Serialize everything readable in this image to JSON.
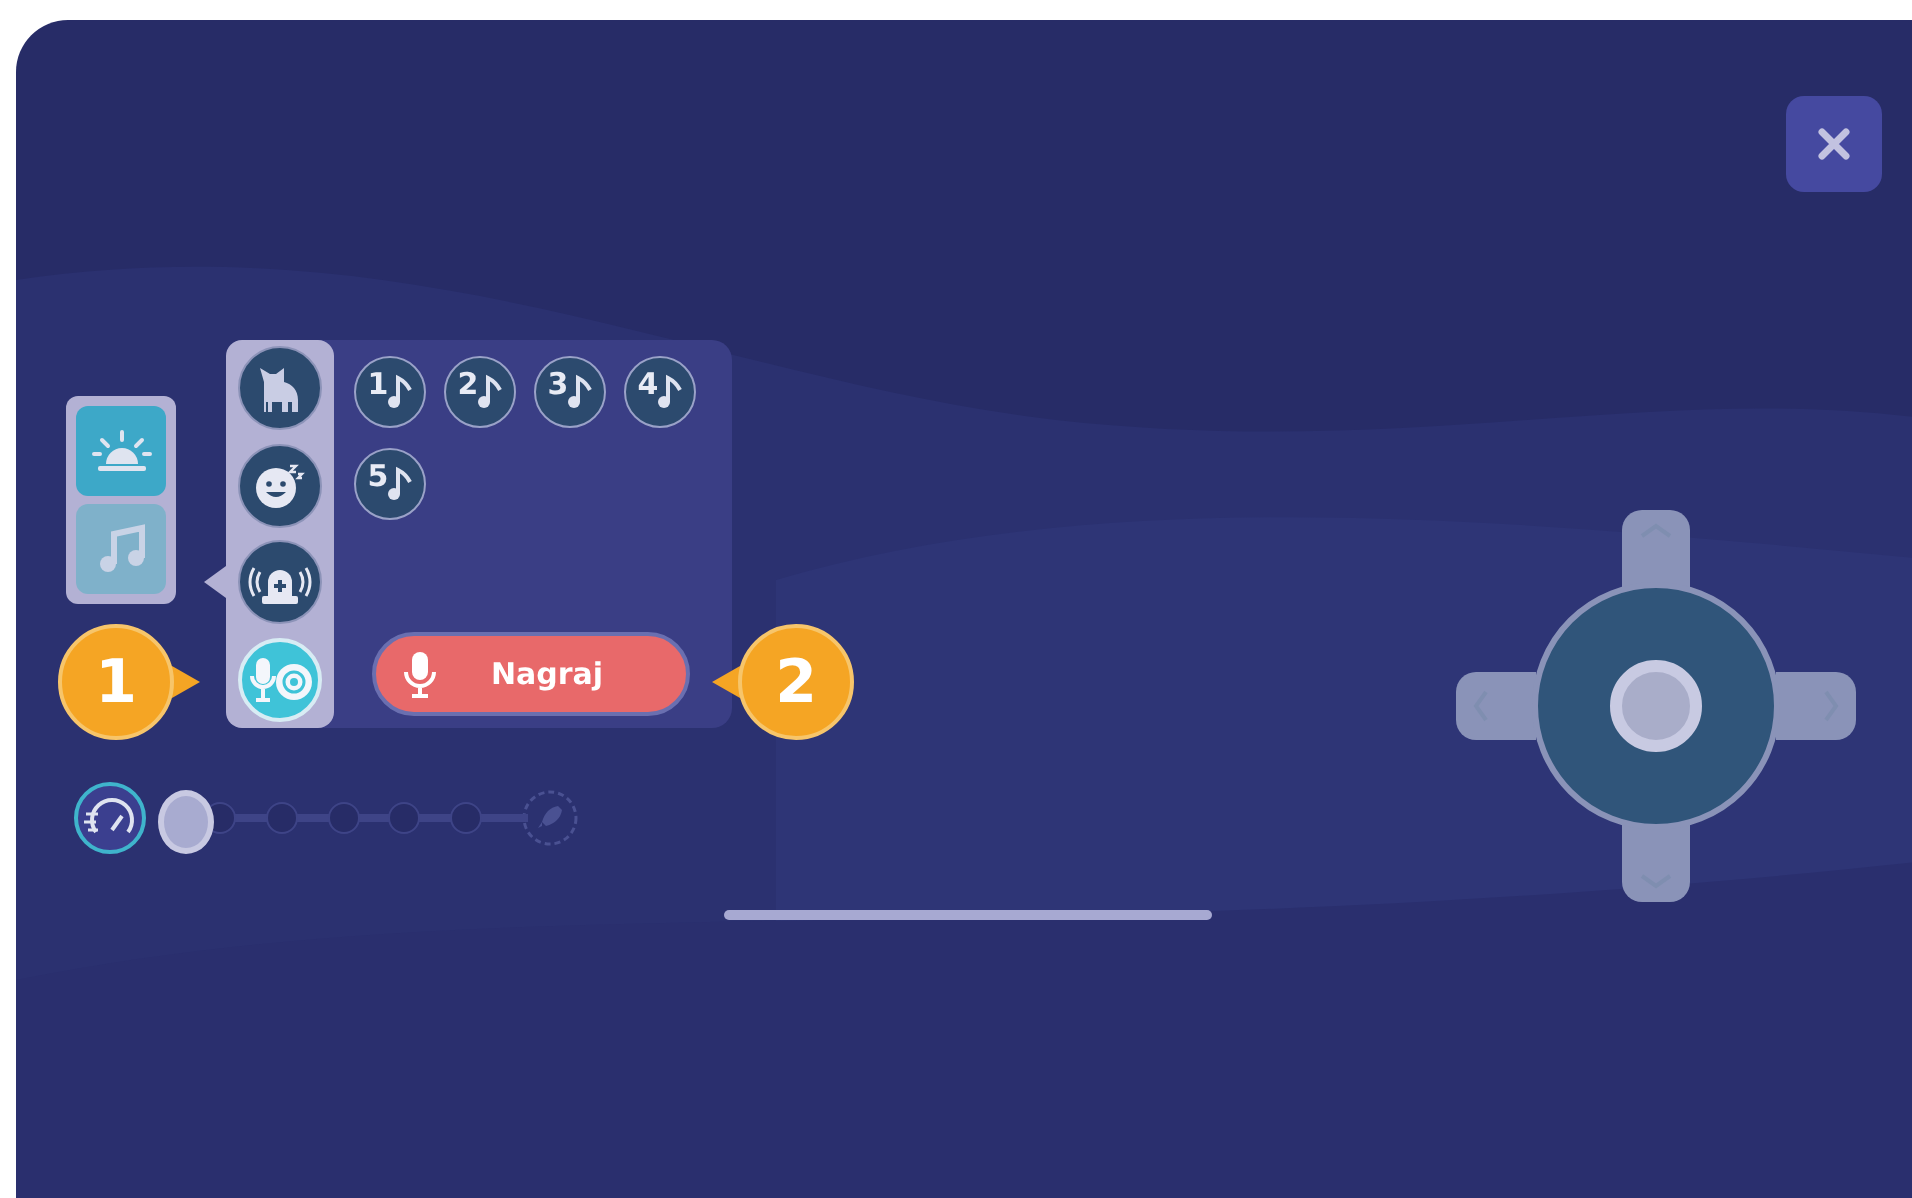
{
  "modes": [
    {
      "kind": "sunrise",
      "selected": false
    },
    {
      "kind": "music",
      "selected": true
    }
  ],
  "sound_categories": [
    {
      "kind": "cat",
      "selected": false
    },
    {
      "kind": "baby",
      "selected": false
    },
    {
      "kind": "siren",
      "selected": false
    },
    {
      "kind": "recording",
      "selected": true
    }
  ],
  "melodies": [
    {
      "label": "1"
    },
    {
      "label": "2"
    },
    {
      "label": "3"
    },
    {
      "label": "4"
    },
    {
      "label": "5"
    }
  ],
  "record_button": {
    "label": "Nagraj"
  },
  "callouts": [
    {
      "label": "1"
    },
    {
      "label": "2"
    }
  ],
  "speed_slider": {
    "level": 0
  }
}
